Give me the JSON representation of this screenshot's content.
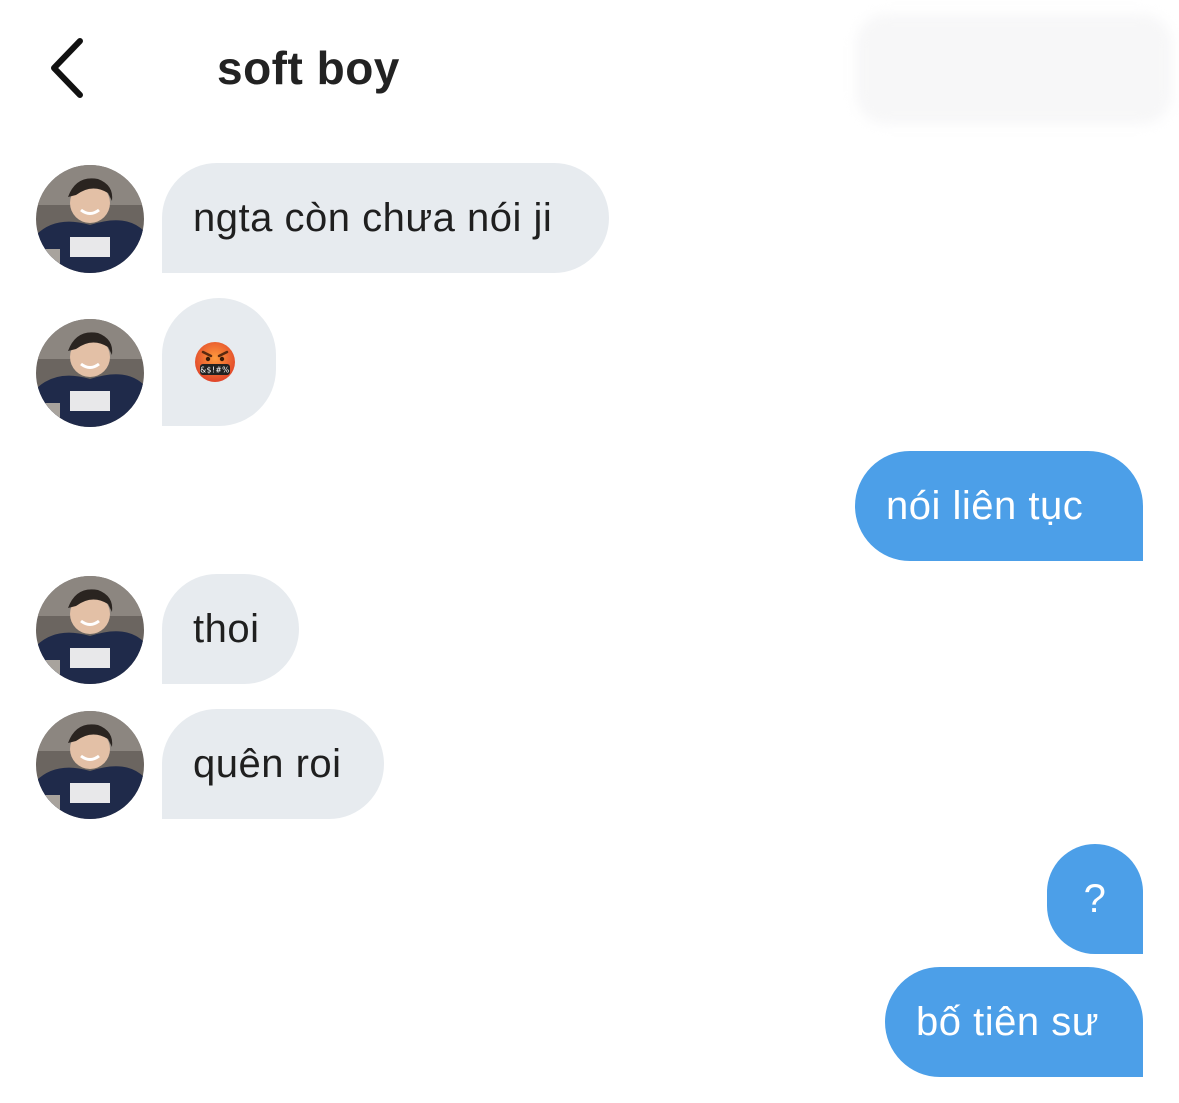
{
  "header": {
    "title": "soft boy",
    "back_icon": "chevron-left-icon"
  },
  "colors": {
    "incoming_bubble": "#e7ebef",
    "outgoing_bubble": "#4c9fe8",
    "outgoing_text": "#ffffff",
    "incoming_text": "#1f1f1f"
  },
  "messages": [
    {
      "direction": "incoming",
      "text": "ngta còn chưa nói ji"
    },
    {
      "direction": "incoming",
      "type": "emoji",
      "emoji": "face-with-symbols-on-mouth-icon",
      "symbols": "&$!#%"
    },
    {
      "direction": "outgoing",
      "text": "nói liên tục"
    },
    {
      "direction": "incoming",
      "text": "thoi"
    },
    {
      "direction": "incoming",
      "text": "quên roi"
    },
    {
      "direction": "outgoing",
      "text": "?"
    },
    {
      "direction": "outgoing",
      "text": "bố tiên sư"
    }
  ]
}
